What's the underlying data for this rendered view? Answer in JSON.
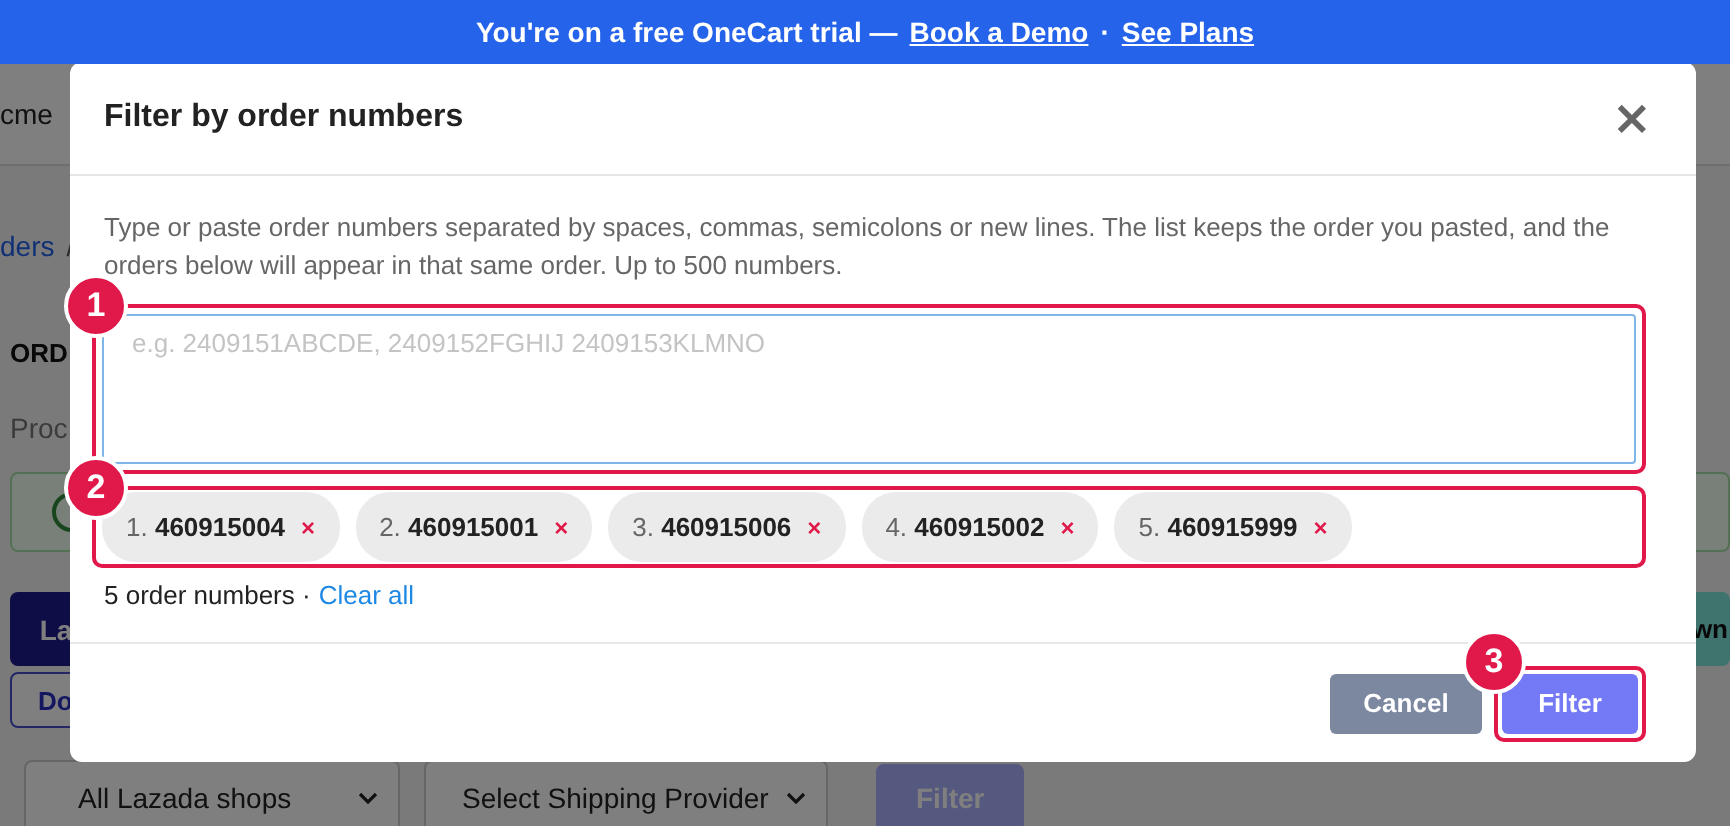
{
  "banner": {
    "text": "You're on a free OneCart trial —",
    "links": [
      {
        "label": "Book a Demo"
      },
      {
        "label": "See Plans"
      }
    ],
    "separator": "·"
  },
  "background_page": {
    "header_text": "cme",
    "breadcrumb": {
      "link": "ders",
      "separator": "/"
    },
    "heading": "ORD",
    "subtext": "Proc",
    "buttons": [
      {
        "label": "La",
        "kind": "primary"
      },
      {
        "label": "wn",
        "kind": "teal"
      },
      {
        "label": "Do",
        "kind": "outline"
      }
    ],
    "filters": {
      "selects": [
        "All Lazada shops",
        "Select Shipping Provider"
      ],
      "button": "Filter"
    }
  },
  "modal": {
    "title": "Filter by order numbers",
    "close": "×",
    "description": "Type or paste order numbers separated by spaces, commas, semicolons or new lines. The list keeps the order you pasted, and the orders below will appear in that same order. Up to 500 numbers.",
    "input": {
      "placeholder": "e.g. 2409151ABCDE, 2409152FGHIJ 2409153KLMNO"
    },
    "chips": [
      {
        "index": "1.",
        "number": "460915004",
        "remove": "×"
      },
      {
        "index": "2.",
        "number": "460915001",
        "remove": "×"
      },
      {
        "index": "3.",
        "number": "460915006",
        "remove": "×"
      },
      {
        "index": "4.",
        "number": "460915002",
        "remove": "×"
      },
      {
        "index": "5.",
        "number": "460915999",
        "remove": "×"
      }
    ],
    "count_text": "5 order numbers ·",
    "clear_link": "Clear all",
    "buttons": [
      {
        "label": "Cancel",
        "kind": "secondary"
      },
      {
        "label": "Filter",
        "kind": "primary"
      }
    ]
  },
  "annotations": [
    {
      "number": "1"
    },
    {
      "number": "2"
    },
    {
      "number": "3"
    }
  ]
}
